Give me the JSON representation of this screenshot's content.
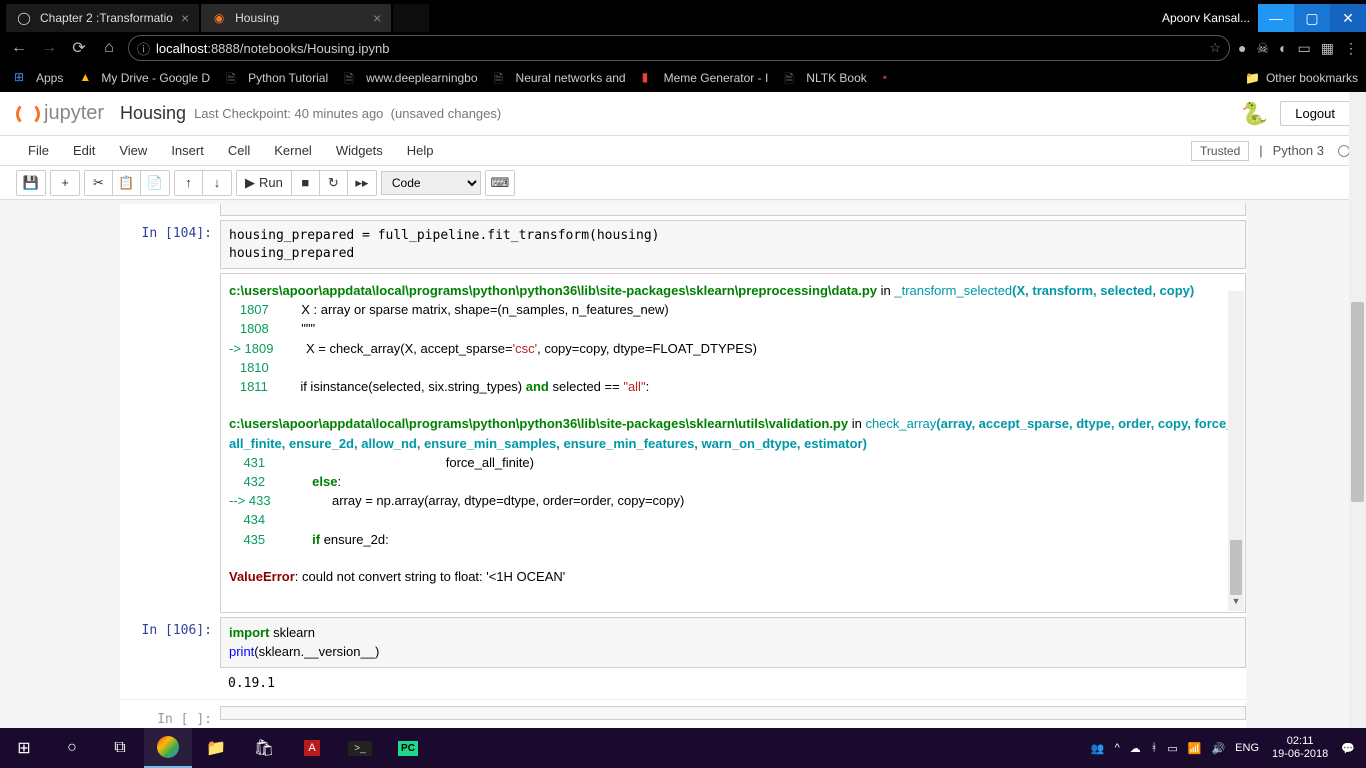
{
  "browser": {
    "tabs": [
      {
        "title": "Chapter 2 :Transformatio",
        "fav": "github"
      },
      {
        "title": "Housing",
        "fav": "jupyter",
        "active": true
      }
    ],
    "user": "Apoorv Kansal...",
    "url_host": "localhost",
    "url_port": ":8888",
    "url_path": "/notebooks/Housing.ipynb",
    "bookmarks": {
      "apps": "Apps",
      "items": [
        "My Drive - Google D",
        "Python Tutorial",
        "www.deeplearningbo",
        "Neural networks and",
        "Meme Generator - I",
        "NLTK Book"
      ],
      "other": "Other bookmarks"
    }
  },
  "jupyter": {
    "logo_text": "jupyter",
    "title": "Housing",
    "checkpoint": "Last Checkpoint: 40 minutes ago",
    "save_status": "(unsaved changes)",
    "logout": "Logout",
    "menus": [
      "File",
      "Edit",
      "View",
      "Insert",
      "Cell",
      "Kernel",
      "Widgets",
      "Help"
    ],
    "trusted": "Trusted",
    "kernel": "Python 3",
    "run_label": "Run",
    "cell_type": "Code"
  },
  "cells": {
    "c104": {
      "prompt": "In [104]:",
      "code": "housing_prepared = full_pipeline.fit_transform(housing)\nhousing_prepared",
      "trace": {
        "path1": "c:\\users\\apoor\\appdata\\local\\programs\\python\\python36\\lib\\site-packages\\sklearn\\preprocessing\\data.py",
        "in1": " in ",
        "func1": "_transform_selected",
        "args1": "(X, transform, selected, copy)",
        "l1807_n": "   1807",
        "l1807": "         X : array or sparse matrix, shape=(n_samples, n_features_new)",
        "l1808_n": "   1808",
        "l1808": "         \"\"\"",
        "l1809_n": "-> 1809",
        "l1809_a": "         X = check_array(X, accept_sparse=",
        "l1809_s": "'csc'",
        "l1809_b": ", copy=copy, dtype=FLOAT_DTYPES)",
        "l1810_n": "   1810",
        "l1810": "",
        "l1811_n": "   1811",
        "l1811_a": "         if isinstance(selected, six.string_types) ",
        "l1811_kw": "and",
        "l1811_b": " selected == ",
        "l1811_s": "\"all\"",
        "l1811_c": ":",
        "path2": "c:\\users\\apoor\\appdata\\local\\programs\\python\\python36\\lib\\site-packages\\sklearn\\utils\\validation.py",
        "in2": " in ",
        "func2": "check_array",
        "args2": "(array, accept_sparse, dtype, order, copy, force_all_finite, ensure_2d, allow_nd, ensure_min_samples, ensure_min_features, warn_on_dtype, estimator)",
        "l431_n": "    431",
        "l431": "                                                  force_all_finite)",
        "l432_n": "    432",
        "l432_a": "             ",
        "l432_kw": "else",
        "l432_b": ":",
        "l433_n": "--> 433",
        "l433": "                 array = np.array(array, dtype=dtype, order=order, copy=copy)",
        "l434_n": "    434",
        "l434": "",
        "l435_n": "    435",
        "l435_a": "             ",
        "l435_kw": "if",
        "l435_b": " ensure_2d:",
        "err_name": "ValueError",
        "err_msg": ": could not convert string to float: '<1H OCEAN'"
      }
    },
    "c106": {
      "prompt": "In [106]:",
      "code_l1_kw": "import",
      "code_l1_rest": " sklearn",
      "code_l2_a": "print",
      "code_l2_b": "(sklearn.__version__)",
      "output": "0.19.1"
    },
    "cEmpty": {
      "prompt": "In [ ]:"
    }
  },
  "taskbar": {
    "time": "02:11",
    "date": "19-06-2018",
    "lang": "ENG"
  }
}
